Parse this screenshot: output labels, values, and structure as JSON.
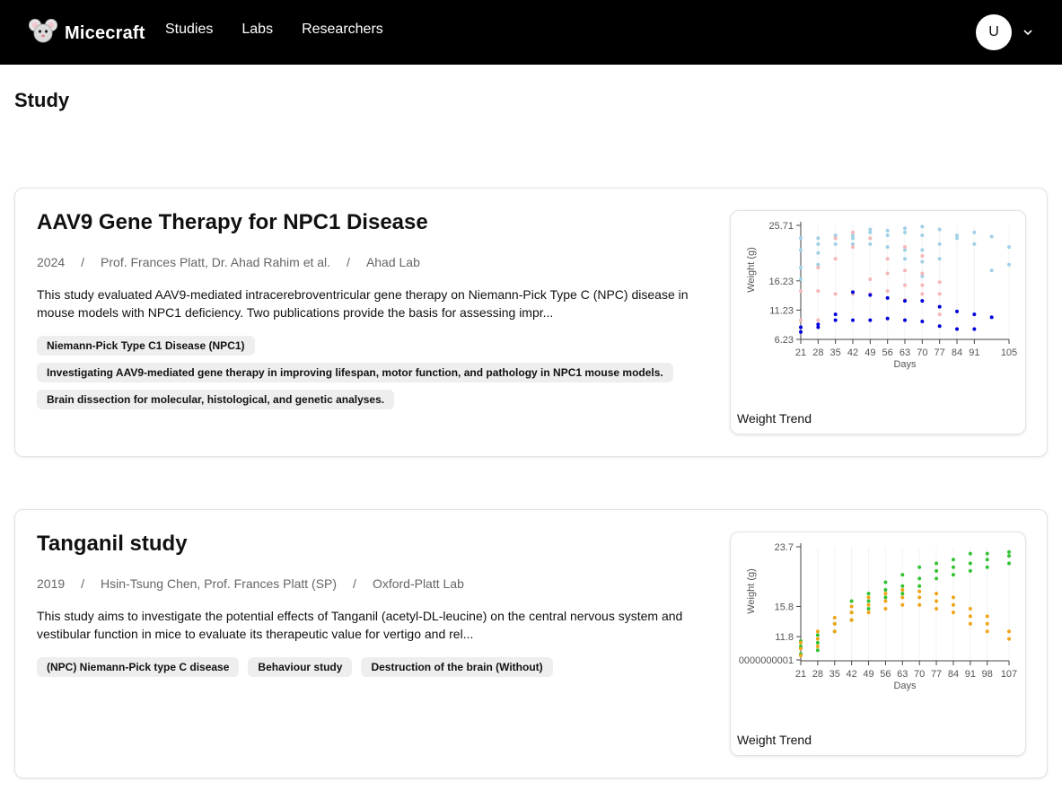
{
  "header": {
    "brand": "Micecraft",
    "nav": [
      "Studies",
      "Labs",
      "Researchers"
    ],
    "user_initial": "U"
  },
  "page": {
    "title": "Study"
  },
  "studies": [
    {
      "title": "AAV9 Gene Therapy for NPC1 Disease",
      "year": "2024",
      "authors": "Prof. Frances Platt, Dr. Ahad Rahim et al.",
      "lab": "Ahad Lab",
      "description": "This study evaluated AAV9-mediated intracerebroventricular gene therapy on Niemann-Pick Type C (NPC) disease in mouse models with NPC1 deficiency. Two publications provide the basis for assessing impr...",
      "tags": [
        "Niemann-Pick Type C1 Disease (NPC1)",
        "Investigating AAV9-mediated gene therapy in improving lifespan, motor function, and pathology in NPC1 mouse models.",
        "Brain dissection for molecular, histological, and genetic analyses."
      ],
      "chart_caption": "Weight Trend"
    },
    {
      "title": "Tanganil study",
      "year": "2019",
      "authors": "Hsin-Tsung Chen, Prof. Frances Platt (SP)",
      "lab": "Oxford-Platt Lab",
      "description": "This study aims to investigate the potential effects of Tanganil (acetyl-DL-leucine) on the central nervous system and vestibular function in mice to evaluate its therapeutic value for vertigo and rel...",
      "tags": [
        "(NPC) Niemann-Pick type C disease",
        "Behaviour study",
        "Destruction of the brain (Without)"
      ],
      "chart_caption": "Weight Trend"
    }
  ],
  "chart_data": [
    {
      "type": "scatter",
      "xlabel": "Days",
      "ylabel": "Weight (g)",
      "x_ticks": [
        "21",
        "28",
        "35",
        "42",
        "49",
        "56",
        "63",
        "70",
        "77",
        "84",
        "91",
        "105"
      ],
      "y_ticks": [
        "6.23",
        "11.23",
        "16.23",
        "25.71"
      ],
      "xlim": [
        21,
        105
      ],
      "ylim": [
        6.23,
        25.71
      ],
      "series": [
        {
          "color": "#9fd0e6",
          "points": [
            [
              21,
              16.5
            ],
            [
              21,
              18.5
            ],
            [
              21,
              21.5
            ],
            [
              21,
              23.5
            ],
            [
              28,
              19
            ],
            [
              28,
              21
            ],
            [
              28,
              22.5
            ],
            [
              28,
              23.5
            ],
            [
              35,
              22.5
            ],
            [
              35,
              23.5
            ],
            [
              35,
              24
            ],
            [
              42,
              22.5
            ],
            [
              42,
              23.5
            ],
            [
              42,
              24
            ],
            [
              49,
              22.5
            ],
            [
              49,
              23.5
            ],
            [
              49,
              24.5
            ],
            [
              49,
              25
            ],
            [
              56,
              22
            ],
            [
              56,
              24
            ],
            [
              56,
              24.8
            ],
            [
              63,
              20
            ],
            [
              63,
              21.5
            ],
            [
              63,
              24.5
            ],
            [
              63,
              25.2
            ],
            [
              70,
              17
            ],
            [
              70,
              19.5
            ],
            [
              70,
              21.5
            ],
            [
              70,
              24
            ],
            [
              70,
              25.5
            ],
            [
              77,
              20
            ],
            [
              77,
              22.5
            ],
            [
              77,
              25
            ],
            [
              84,
              24
            ],
            [
              84,
              23.5
            ],
            [
              91,
              22.5
            ],
            [
              91,
              24.5
            ],
            [
              98,
              18
            ],
            [
              98,
              23.8
            ],
            [
              105,
              19
            ],
            [
              105,
              22
            ]
          ]
        },
        {
          "color": "#f4b6b6",
          "points": [
            [
              21,
              9.5
            ],
            [
              21,
              14.5
            ],
            [
              28,
              9.5
            ],
            [
              28,
              14.5
            ],
            [
              28,
              18.5
            ],
            [
              35,
              14
            ],
            [
              35,
              20
            ],
            [
              35,
              23.5
            ],
            [
              42,
              14
            ],
            [
              42,
              22
            ],
            [
              42,
              24.5
            ],
            [
              49,
              14
            ],
            [
              49,
              16.5
            ],
            [
              49,
              23.5
            ],
            [
              56,
              14.5
            ],
            [
              56,
              17.5
            ],
            [
              56,
              20
            ],
            [
              63,
              13
            ],
            [
              63,
              15.5
            ],
            [
              63,
              18
            ],
            [
              63,
              22
            ],
            [
              70,
              14
            ],
            [
              70,
              15.5
            ],
            [
              70,
              17.5
            ],
            [
              70,
              20.5
            ],
            [
              77,
              10.5
            ],
            [
              77,
              14
            ],
            [
              77,
              16
            ]
          ]
        },
        {
          "color": "#0000dd",
          "points": [
            [
              21,
              7.5
            ],
            [
              21,
              8.3
            ],
            [
              28,
              8.3
            ],
            [
              28,
              8.8
            ],
            [
              35,
              9.5
            ],
            [
              35,
              10.5
            ],
            [
              42,
              9.5
            ],
            [
              42,
              14.3
            ],
            [
              49,
              9.5
            ],
            [
              49,
              13.8
            ],
            [
              56,
              9.8
            ],
            [
              56,
              13.3
            ],
            [
              63,
              9.5
            ],
            [
              63,
              12.8
            ],
            [
              70,
              9.3
            ],
            [
              70,
              12.8
            ],
            [
              77,
              8.5
            ],
            [
              77,
              11.8
            ],
            [
              84,
              8
            ],
            [
              84,
              11
            ],
            [
              91,
              8
            ],
            [
              91,
              10.5
            ],
            [
              98,
              10
            ]
          ]
        }
      ]
    },
    {
      "type": "scatter",
      "xlabel": "Days",
      "ylabel": "Weight (g)",
      "x_ticks": [
        "21",
        "28",
        "35",
        "42",
        "49",
        "56",
        "63",
        "70",
        "77",
        "84",
        "91",
        "98",
        "107"
      ],
      "y_ticks": [
        "0000000001",
        "11.8",
        "15.8",
        "23.7"
      ],
      "xlim": [
        21,
        107
      ],
      "ylim": [
        8.6,
        23.7
      ],
      "series": [
        {
          "color": "#33c233",
          "points": [
            [
              21,
              9.5
            ],
            [
              21,
              10.5
            ],
            [
              21,
              11.2
            ],
            [
              28,
              10
            ],
            [
              28,
              11
            ],
            [
              28,
              12
            ],
            [
              35,
              12.5
            ],
            [
              35,
              13.5
            ],
            [
              42,
              14
            ],
            [
              42,
              15
            ],
            [
              42,
              16.5
            ],
            [
              49,
              15.5
            ],
            [
              49,
              16.5
            ],
            [
              49,
              17.5
            ],
            [
              56,
              17
            ],
            [
              56,
              18
            ],
            [
              56,
              19
            ],
            [
              63,
              17.5
            ],
            [
              63,
              18.5
            ],
            [
              63,
              20
            ],
            [
              70,
              18.5
            ],
            [
              70,
              19.5
            ],
            [
              70,
              21
            ],
            [
              77,
              19.5
            ],
            [
              77,
              20.5
            ],
            [
              77,
              21.5
            ],
            [
              84,
              20
            ],
            [
              84,
              21
            ],
            [
              84,
              22
            ],
            [
              91,
              20.5
            ],
            [
              91,
              21.5
            ],
            [
              91,
              22.8
            ],
            [
              98,
              21
            ],
            [
              98,
              22
            ],
            [
              98,
              22.8
            ],
            [
              107,
              21.5
            ],
            [
              107,
              22.5
            ],
            [
              107,
              23
            ]
          ]
        },
        {
          "color": "#f0a418",
          "points": [
            [
              21,
              9.3
            ],
            [
              21,
              10.2
            ],
            [
              21,
              11
            ],
            [
              28,
              10.5
            ],
            [
              28,
              11.5
            ],
            [
              28,
              12.5
            ],
            [
              35,
              12.5
            ],
            [
              35,
              13.5
            ],
            [
              35,
              14.3
            ],
            [
              42,
              14
            ],
            [
              42,
              15
            ],
            [
              42,
              15.8
            ],
            [
              49,
              15
            ],
            [
              49,
              16
            ],
            [
              49,
              17
            ],
            [
              56,
              15.5
            ],
            [
              56,
              16.5
            ],
            [
              56,
              17.5
            ],
            [
              63,
              16
            ],
            [
              63,
              17
            ],
            [
              63,
              18
            ],
            [
              70,
              16
            ],
            [
              70,
              17
            ],
            [
              70,
              17.8
            ],
            [
              77,
              15.5
            ],
            [
              77,
              16.5
            ],
            [
              77,
              17.5
            ],
            [
              84,
              15
            ],
            [
              84,
              16
            ],
            [
              84,
              17
            ],
            [
              91,
              13.5
            ],
            [
              91,
              14.5
            ],
            [
              91,
              15.5
            ],
            [
              98,
              12.5
            ],
            [
              98,
              13.5
            ],
            [
              98,
              14.5
            ],
            [
              107,
              11.5
            ],
            [
              107,
              12.5
            ]
          ]
        }
      ]
    }
  ]
}
